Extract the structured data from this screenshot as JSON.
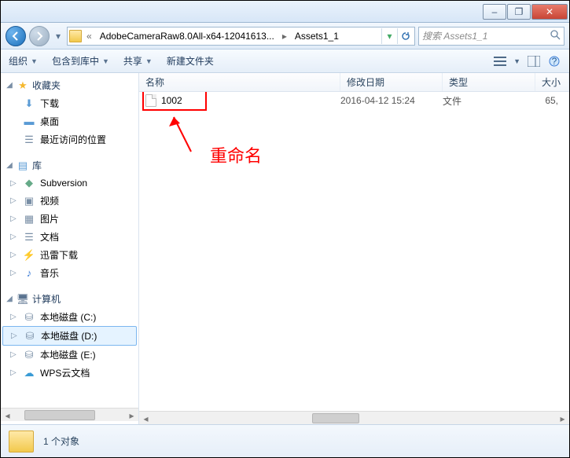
{
  "titlebar": {
    "minimize": "–",
    "maximize": "❐",
    "close": "✕"
  },
  "nav": {
    "chevrons": "«",
    "crumb1": "AdobeCameraRaw8.0All-x64-12041613...",
    "sep": "▸",
    "crumb2": "Assets1_1",
    "search_placeholder": "搜索 Assets1_1"
  },
  "toolbar": {
    "organize": "组织",
    "include": "包含到库中",
    "share": "共享",
    "newfolder": "新建文件夹"
  },
  "sidebar": {
    "fav": "收藏夹",
    "downloads": "下载",
    "desktop": "桌面",
    "recent": "最近访问的位置",
    "libraries": "库",
    "subversion": "Subversion",
    "videos": "视频",
    "pictures": "图片",
    "documents": "文档",
    "thunder": "迅雷下载",
    "music": "音乐",
    "computer": "计算机",
    "diskC": "本地磁盘 (C:)",
    "diskD": "本地磁盘 (D:)",
    "diskE": "本地磁盘 (E:)",
    "wps": "WPS云文档"
  },
  "columns": {
    "name": "名称",
    "date": "修改日期",
    "type": "类型",
    "size": "大小"
  },
  "files": [
    {
      "name": "1002",
      "date": "2016-04-12 15:24",
      "type": "文件",
      "size": "65,"
    }
  ],
  "annotation": {
    "label": "重命名"
  },
  "status": {
    "count": "1 个对象"
  }
}
